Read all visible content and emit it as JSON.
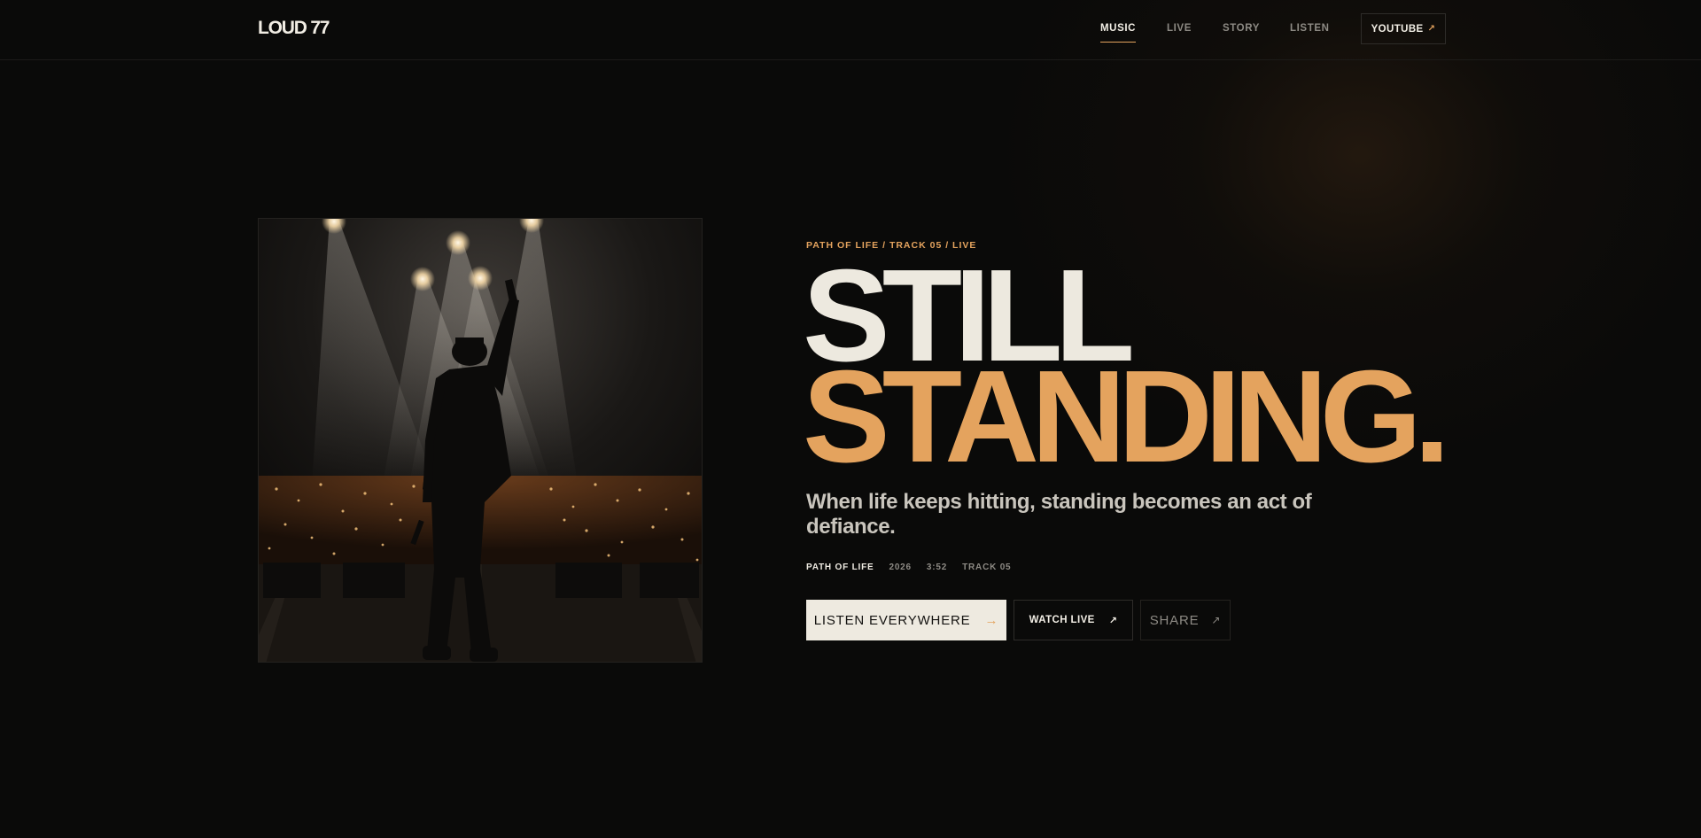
{
  "header": {
    "logo": "LOUD 77",
    "nav": [
      {
        "label": "MUSIC",
        "active": true
      },
      {
        "label": "LIVE",
        "active": false
      },
      {
        "label": "STORY",
        "active": false
      },
      {
        "label": "LISTEN",
        "active": false
      }
    ],
    "youtube_label": "YOUTUBE"
  },
  "hero": {
    "eyebrow": "PATH OF LIFE / TRACK 05 / LIVE",
    "title_line1": "STILL",
    "title_line2": "STANDING.",
    "tagline": "When life keeps hitting, standing becomes an act of defiance.",
    "meta": [
      "PATH OF LIFE",
      "2026",
      "3:52",
      "TRACK 05"
    ],
    "buttons": {
      "listen": "LISTEN EVERYWHERE",
      "watch": "WATCH LIVE",
      "share": "SHARE"
    }
  },
  "colors": {
    "accent": "#e4a35e",
    "background": "#0a0a09",
    "text": "#eeeae0",
    "muted": "#8d8a84"
  },
  "icons": {
    "external": "arrow-up-right-icon",
    "forward": "arrow-right-icon"
  }
}
